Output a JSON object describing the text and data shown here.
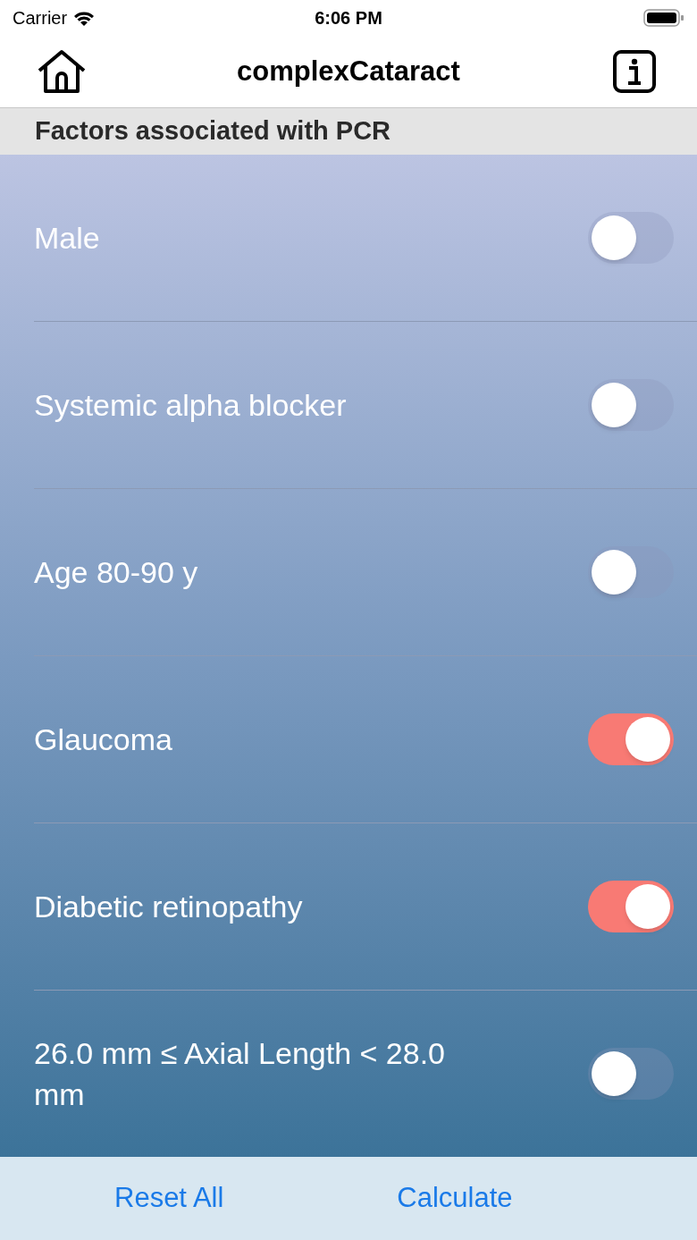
{
  "status_bar": {
    "carrier": "Carrier",
    "time": "6:06 PM"
  },
  "nav": {
    "title": "complexCataract"
  },
  "section": {
    "title": "Factors associated with PCR"
  },
  "factors": [
    {
      "label": "Male",
      "on": false
    },
    {
      "label": "Systemic alpha blocker",
      "on": false
    },
    {
      "label": "Age 80-90 y",
      "on": false
    },
    {
      "label": "Glaucoma",
      "on": true
    },
    {
      "label": "Diabetic retinopathy",
      "on": true
    },
    {
      "label": "26.0 mm ≤ Axial Length < 28.0 mm",
      "on": false
    }
  ],
  "buttons": [
    "Reset All",
    "Calculate"
  ]
}
